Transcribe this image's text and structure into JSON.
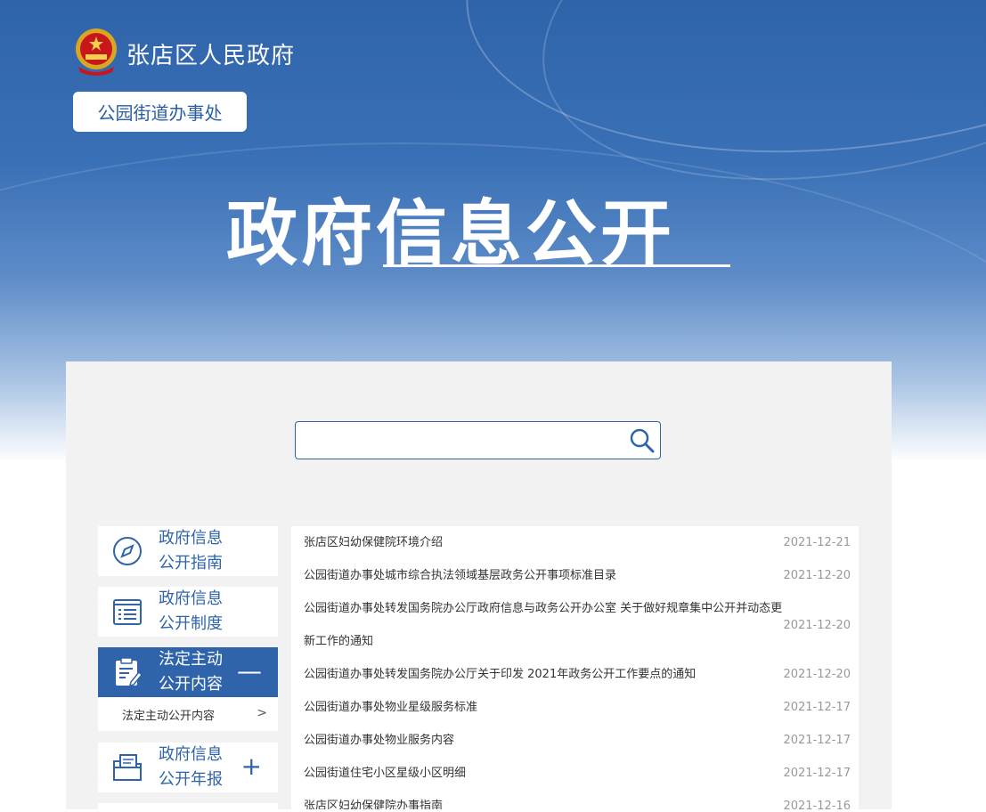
{
  "header": {
    "site_name": "张店区人民政府",
    "sub_unit": "公园街道办事处",
    "banner_title": "政府信息公开"
  },
  "search": {
    "placeholder": ""
  },
  "sidebar": {
    "items": [
      {
        "line1": "政府信息",
        "line2": "公开指南",
        "icon": "compass-icon"
      },
      {
        "line1": "政府信息",
        "line2": "公开制度",
        "icon": "list-icon"
      },
      {
        "line1": "法定主动",
        "line2": "公开内容",
        "icon": "clipboard-icon",
        "toggle": "—"
      },
      {
        "line1": "政府信息",
        "line2": "公开年报",
        "icon": "folder-icon",
        "toggle": "+"
      }
    ],
    "sub_item": {
      "label": "法定主动公开内容",
      "chevron": ">"
    }
  },
  "list": [
    {
      "title": "张店区妇幼保健院环境介绍",
      "date": "2021-12-21"
    },
    {
      "title": "公园街道办事处城市综合执法领域基层政务公开事项标准目录",
      "date": "2021-12-20"
    },
    {
      "title": "公园街道办事处转发国务院办公厅政府信息与政务公开办公室 关于做好规章集中公开并动态更新工作的通知",
      "date": "2021-12-20"
    },
    {
      "title": "公园街道办事处转发国务院办公厅关于印发 2021年政务公开工作要点的通知",
      "date": "2021-12-20"
    },
    {
      "title": "公园街道办事处物业星级服务标准",
      "date": "2021-12-17"
    },
    {
      "title": "公园街道办事处物业服务内容",
      "date": "2021-12-17"
    },
    {
      "title": "公园街道住宅小区星级小区明细",
      "date": "2021-12-17"
    },
    {
      "title": "张店区妇幼保健院办事指南",
      "date": "2021-12-16"
    }
  ],
  "colors": {
    "primary": "#2f64aa",
    "panel_bg": "#f2f2f2"
  }
}
